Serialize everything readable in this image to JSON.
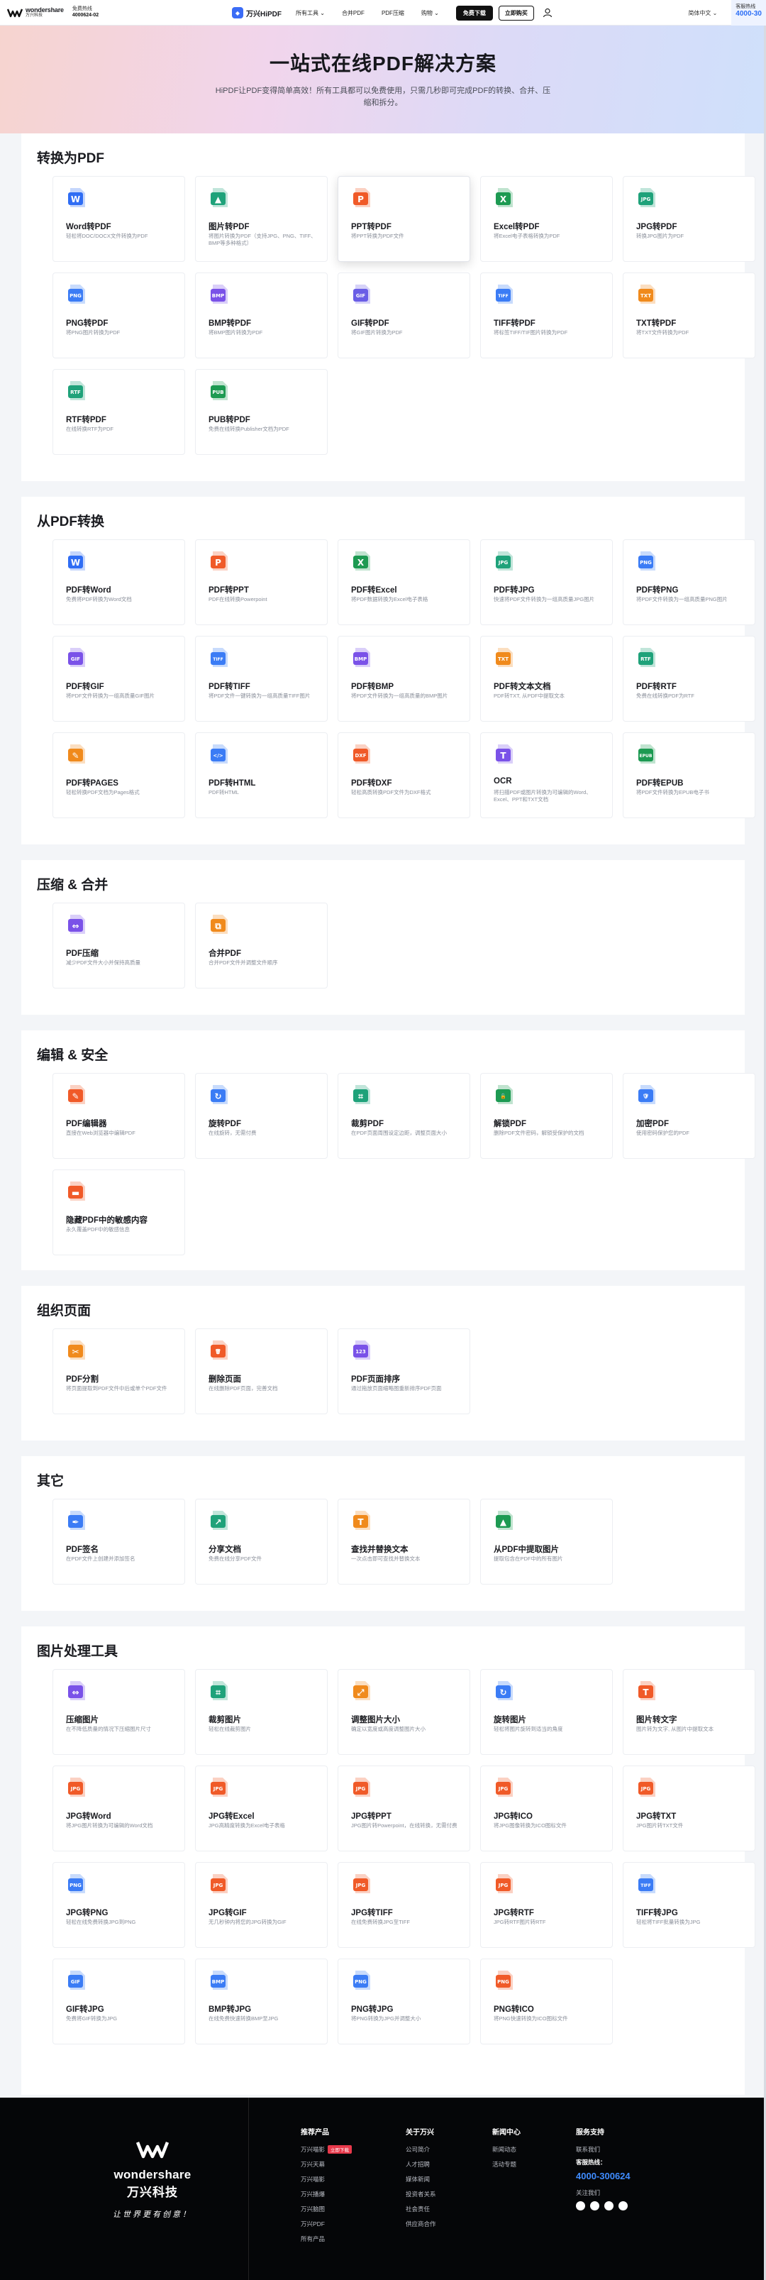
{
  "header": {
    "logo_top": "wondershare",
    "logo_bottom": "万兴科技",
    "hotline_label": "免费热线",
    "hotline_number": "4000624-02",
    "brand": "万兴HiPDF",
    "nav": [
      "所有工具 ⌄",
      "合并PDF",
      "PDF压缩",
      "购物 ⌄"
    ],
    "download_label": "免费下载",
    "buy_label": "立即购买",
    "locale": "简体中文 ⌄",
    "hotline_right_label": "客服热线",
    "hotline_right_number": "4000-30"
  },
  "hero": {
    "title": "一站式在线PDF解决方案",
    "subtitle": "HiPDF让PDF变得简单高效！所有工具都可以免费使用，只需几秒即可完成PDF的转换、合并、压缩和拆分。"
  },
  "sections": [
    {
      "title": "转换为PDF",
      "cards": [
        {
          "title": "Word转PDF",
          "desc": "轻松将DOC/DOCX文件转换为PDF",
          "icon": "word-icon",
          "color": "#2f6df4",
          "label": "W"
        },
        {
          "title": "图片转PDF",
          "desc": "将图片转换为PDF（支持JPG、PNG、TIFF、BMP等多种格式）",
          "icon": "image-icon",
          "color": "#1fa27a",
          "label": "▲"
        },
        {
          "title": "PPT转PDF",
          "desc": "将PPT转换为PDF文件",
          "icon": "ppt-icon",
          "color": "#f05a28",
          "label": "P",
          "highlight": true
        },
        {
          "title": "Excel转PDF",
          "desc": "将Excel电子表格转换为PDF",
          "icon": "excel-icon",
          "color": "#1d9a52",
          "label": "X"
        },
        {
          "title": "JPG转PDF",
          "desc": "转换JPG图片为PDF",
          "icon": "jpg-icon",
          "color": "#1fa27a",
          "label": "JPG"
        },
        {
          "title": "PNG转PDF",
          "desc": "将PNG图片转换为PDF",
          "icon": "png-icon",
          "color": "#3b7cf5",
          "label": "PNG"
        },
        {
          "title": "BMP转PDF",
          "desc": "将BMP图片转换为PDF",
          "icon": "bmp-icon",
          "color": "#7a52e8",
          "label": "BMP"
        },
        {
          "title": "GIF转PDF",
          "desc": "将GIF图片转换为PDF",
          "icon": "gif-icon",
          "color": "#6a5ee6",
          "label": "GIF"
        },
        {
          "title": "TIFF转PDF",
          "desc": "将标签TIFF/TIF图片转换为PDF",
          "icon": "tiff-icon",
          "color": "#3b7cf5",
          "label": "TIFF"
        },
        {
          "title": "TXT转PDF",
          "desc": "将TXT文件转换为PDF",
          "icon": "txt-icon",
          "color": "#f08a1c",
          "label": "TXT"
        },
        {
          "title": "RTF转PDF",
          "desc": "在线转换RTF为PDF",
          "icon": "rtf-icon",
          "color": "#1fa27a",
          "label": "RTF"
        },
        {
          "title": "PUB转PDF",
          "desc": "免费在线转换Publisher文档为PDF",
          "icon": "pub-icon",
          "color": "#1d9a52",
          "label": "PUB"
        }
      ]
    },
    {
      "title": "从PDF转换",
      "cards": [
        {
          "title": "PDF转Word",
          "desc": "免费将PDF转换为Word文档",
          "icon": "pdf-to-word-icon",
          "color": "#2f6df4",
          "label": "W"
        },
        {
          "title": "PDF转PPT",
          "desc": "PDF在线转换Powerpoint",
          "icon": "pdf-to-ppt-icon",
          "color": "#f05a28",
          "label": "P"
        },
        {
          "title": "PDF转Excel",
          "desc": "将PDF数据转换为Excel电子表格",
          "icon": "pdf-to-excel-icon",
          "color": "#1d9a52",
          "label": "X"
        },
        {
          "title": "PDF转JPG",
          "desc": "快速将PDF文件转换为一组高质量JPG图片",
          "icon": "pdf-to-jpg-icon",
          "color": "#1fa27a",
          "label": "JPG"
        },
        {
          "title": "PDF转PNG",
          "desc": "将PDF文件转换为一组高质量PNG图片",
          "icon": "pdf-to-png-icon",
          "color": "#3b7cf5",
          "label": "PNG"
        },
        {
          "title": "PDF转GIF",
          "desc": "将PDF文件转换为一组高质量GIF图片",
          "icon": "pdf-to-gif-icon",
          "color": "#7a52e8",
          "label": "GIF"
        },
        {
          "title": "PDF转TIFF",
          "desc": "将PDF文件一键转换为一组高质量TIFF图片",
          "icon": "pdf-to-tiff-icon",
          "color": "#3b7cf5",
          "label": "TIFF"
        },
        {
          "title": "PDF转BMP",
          "desc": "将PDF文件转换为一组高质量的BMP图片",
          "icon": "pdf-to-bmp-icon",
          "color": "#7a52e8",
          "label": "BMP"
        },
        {
          "title": "PDF转文本文档",
          "desc": "PDF转TXT, 从PDF中提取文本",
          "icon": "pdf-to-txt-icon",
          "color": "#f08a1c",
          "label": "TXT"
        },
        {
          "title": "PDF转RTF",
          "desc": "免费在线转换PDF为RTF",
          "icon": "pdf-to-rtf-icon",
          "color": "#1fa27a",
          "label": "RTF"
        },
        {
          "title": "PDF转PAGES",
          "desc": "轻松转换PDF文档为Pages格式",
          "icon": "pdf-to-pages-icon",
          "color": "#f08a1c",
          "label": "✎"
        },
        {
          "title": "PDF转HTML",
          "desc": "PDF转HTML",
          "icon": "pdf-to-html-icon",
          "color": "#3b7cf5",
          "label": "</>"
        },
        {
          "title": "PDF转DXF",
          "desc": "轻松高质转换PDF文件为DXF格式",
          "icon": "pdf-to-dxf-icon",
          "color": "#f05a28",
          "label": "DXF"
        },
        {
          "title": "OCR",
          "desc": "将扫描PDF或图片转换为可编辑的Word、Excel、PPT和TXT文档",
          "icon": "ocr-icon",
          "color": "#7a52e8",
          "label": "T"
        },
        {
          "title": "PDF转EPUB",
          "desc": "将PDF文件转换为EPUB电子书",
          "icon": "pdf-to-epub-icon",
          "color": "#1d9a52",
          "label": "EPUB"
        }
      ]
    },
    {
      "title": "压缩 & 合并",
      "cards": [
        {
          "title": "PDF压缩",
          "desc": "减少PDF文件大小并保持高质量",
          "icon": "compress-icon",
          "color": "#7a52e8",
          "label": "⇔"
        },
        {
          "title": "合并PDF",
          "desc": "合并PDF文件并调整文件顺序",
          "icon": "merge-icon",
          "color": "#f08a1c",
          "label": "⧉"
        }
      ]
    },
    {
      "title": "编辑 & 安全",
      "cards": [
        {
          "title": "PDF编辑器",
          "desc": "直接在Web浏览器中编辑PDF",
          "icon": "edit-icon",
          "color": "#f05a28",
          "label": "✎"
        },
        {
          "title": "旋转PDF",
          "desc": "在线旋转，无需付费",
          "icon": "rotate-icon",
          "color": "#3b7cf5",
          "label": "↻"
        },
        {
          "title": "裁剪PDF",
          "desc": "在PDF页面周围设定边距，调整页面大小",
          "icon": "crop-icon",
          "color": "#1fa27a",
          "label": "⌗"
        },
        {
          "title": "解锁PDF",
          "desc": "删除PDF文件密码，解锁受保护的文档",
          "icon": "unlock-icon",
          "color": "#1d9a52",
          "label": "🔓"
        },
        {
          "title": "加密PDF",
          "desc": "使用密码保护您的PDF",
          "icon": "lock-icon",
          "color": "#3b7cf5",
          "label": "🛡"
        },
        {
          "title": "隐藏PDF中的敏感内容",
          "desc": "永久覆盖PDF中的敏感信息",
          "icon": "redact-icon",
          "color": "#f05a28",
          "label": "▬"
        }
      ]
    },
    {
      "title": "组织页面",
      "cards": [
        {
          "title": "PDF分割",
          "desc": "将页面提取到PDF文件中后或单个PDF文件",
          "icon": "split-icon",
          "color": "#f08a1c",
          "label": "✂"
        },
        {
          "title": "删除页面",
          "desc": "在线删除PDF页面，完善文档",
          "icon": "delete-page-icon",
          "color": "#f05a28",
          "label": "🗑"
        },
        {
          "title": "PDF页面排序",
          "desc": "通过拖放页面缩略图重新排序PDF页面",
          "icon": "reorder-icon",
          "color": "#7a52e8",
          "label": "123"
        }
      ]
    },
    {
      "title": "其它",
      "cards": [
        {
          "title": "PDF签名",
          "desc": "在PDF文件上创建并添加签名",
          "icon": "sign-icon",
          "color": "#3b7cf5",
          "label": "✒"
        },
        {
          "title": "分享文档",
          "desc": "免费在线分享PDF文件",
          "icon": "share-icon",
          "color": "#1fa27a",
          "label": "↗"
        },
        {
          "title": "查找并替换文本",
          "desc": "一次点击即可查找并替换文本",
          "icon": "find-replace-icon",
          "color": "#f08a1c",
          "label": "T"
        },
        {
          "title": "从PDF中提取图片",
          "desc": "提取包含在PDF中的所有图片",
          "icon": "extract-image-icon",
          "color": "#1d9a52",
          "label": "▲"
        }
      ]
    },
    {
      "title": "图片处理工具",
      "cards": [
        {
          "title": "压缩图片",
          "desc": "在不降低质量的情况下压缩图片尺寸",
          "icon": "compress-image-icon",
          "color": "#7a52e8",
          "label": "⇔"
        },
        {
          "title": "裁剪图片",
          "desc": "轻松在线裁剪图片",
          "icon": "crop-image-icon",
          "color": "#1fa27a",
          "label": "⌗"
        },
        {
          "title": "调整图片大小",
          "desc": "确定以宽度或高度调整图片大小",
          "icon": "resize-image-icon",
          "color": "#f08a1c",
          "label": "⤢"
        },
        {
          "title": "旋转图片",
          "desc": "轻松将图片旋转到适当的角度",
          "icon": "rotate-image-icon",
          "color": "#3b7cf5",
          "label": "↻"
        },
        {
          "title": "图片转文字",
          "desc": "图片转为文字, 从图片中提取文本",
          "icon": "image-to-text-icon",
          "color": "#f05a28",
          "label": "T"
        },
        {
          "title": "JPG转Word",
          "desc": "将JPG图片转换为可编辑的Word文档",
          "icon": "jpg-to-word-icon",
          "color": "#f05a28",
          "label": "JPG"
        },
        {
          "title": "JPG转Excel",
          "desc": "JPG高精度转换为Excel电子表格",
          "icon": "jpg-to-excel-icon",
          "color": "#f05a28",
          "label": "JPG"
        },
        {
          "title": "JPG转PPT",
          "desc": "JPG图片转Powerpoint，在线转换，无需付费",
          "icon": "jpg-to-ppt-icon",
          "color": "#f05a28",
          "label": "JPG"
        },
        {
          "title": "JPG转ICO",
          "desc": "将JPG图像转换为ICO图标文件",
          "icon": "jpg-to-ico-icon",
          "color": "#f05a28",
          "label": "JPG"
        },
        {
          "title": "JPG转TXT",
          "desc": "JPG图片转TXT文件",
          "icon": "jpg-to-txt-icon",
          "color": "#f05a28",
          "label": "JPG"
        },
        {
          "title": "JPG转PNG",
          "desc": "轻松在线免费转换JPG到PNG",
          "icon": "jpg-to-png-icon",
          "color": "#3b7cf5",
          "label": "PNG"
        },
        {
          "title": "JPG转GIF",
          "desc": "无几秒钟内将您的JPG转换为GIF",
          "icon": "jpg-to-gif-icon",
          "color": "#f05a28",
          "label": "JPG"
        },
        {
          "title": "JPG转TIFF",
          "desc": "在线免费转换JPG至TIFF",
          "icon": "jpg-to-tiff-icon",
          "color": "#f05a28",
          "label": "JPG"
        },
        {
          "title": "JPG转RTF",
          "desc": "JPG转RTF图片转RTF",
          "icon": "jpg-to-rtf-icon",
          "color": "#f05a28",
          "label": "JPG"
        },
        {
          "title": "TIFF转JPG",
          "desc": "轻松将TIFF批量转换为JPG",
          "icon": "tiff-to-jpg-icon",
          "color": "#3b7cf5",
          "label": "TIFF"
        },
        {
          "title": "GIF转JPG",
          "desc": "免费将GIF转换为JPG",
          "icon": "gif-to-jpg-icon",
          "color": "#3b7cf5",
          "label": "GIF"
        },
        {
          "title": "BMP转JPG",
          "desc": "在线免费快速转换BMP至JPG",
          "icon": "bmp-to-jpg-icon",
          "color": "#3b7cf5",
          "label": "BMP"
        },
        {
          "title": "PNG转JPG",
          "desc": "将PNG转换为JPG并调整大小",
          "icon": "png-to-jpg-icon",
          "color": "#3b7cf5",
          "label": "PNG"
        },
        {
          "title": "PNG转ICO",
          "desc": "将PNG快速转换为ICO图标文件",
          "icon": "png-to-ico-icon",
          "color": "#f05a28",
          "label": "PNG"
        }
      ]
    }
  ],
  "footer": {
    "logo_en": "wondershare",
    "logo_cn": "万兴科技",
    "slogan": "让世界更有创意！",
    "columns": [
      {
        "title": "推荐产品",
        "items": [
          "万兴喵影",
          "万兴天幕",
          "万兴喵影",
          "万兴播爆",
          "万兴脑图",
          "万兴PDF",
          "所有产品"
        ],
        "tag": "立即下载"
      },
      {
        "title": "关于万兴",
        "items": [
          "公司简介",
          "人才招聘",
          "媒体新闻",
          "投资者关系",
          "社会责任",
          "供应商合作"
        ]
      },
      {
        "title": "新闻中心",
        "items": [
          "新闻动态",
          "活动专题"
        ]
      }
    ],
    "support_title": "服务支持",
    "support_contact": "联系我们",
    "support_hotline_label": "客服热线：",
    "support_hotline": "4000-300624",
    "follow_label": "关注我们"
  }
}
